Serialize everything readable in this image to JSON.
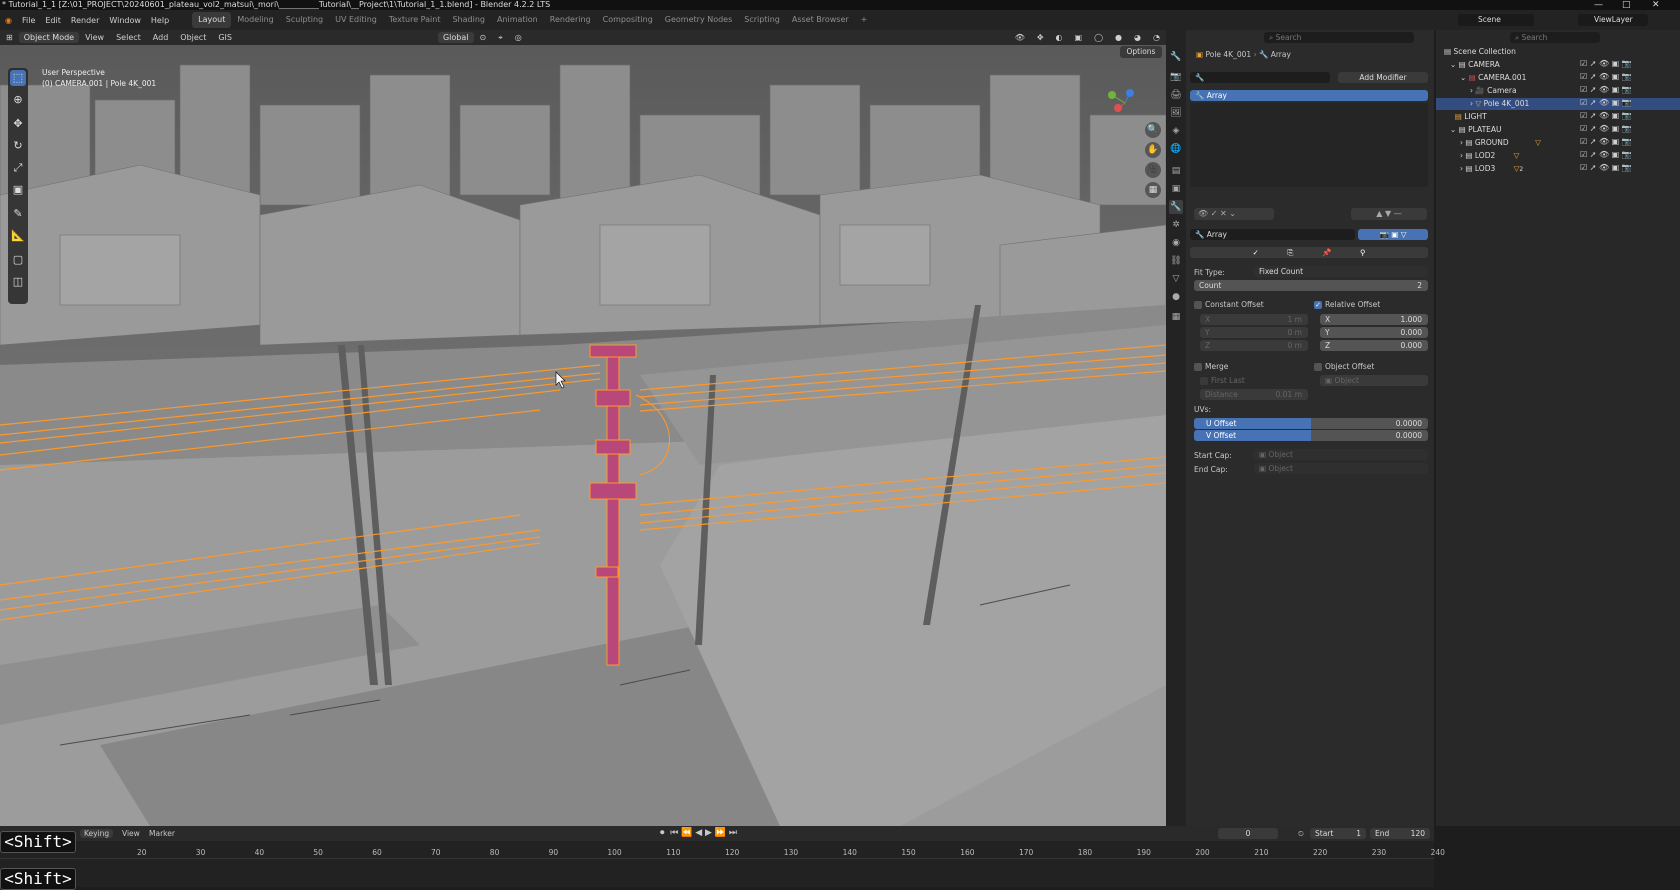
{
  "titlebar": {
    "text": "* Tutorial_1_1 [Z:\\01_PROJECT\\20240601_plateau_vol2_matsui\\_mori\\__________Tutorial\\__Project\\1\\Tutorial_1_1.blend] - Blender 4.2.2 LTS"
  },
  "menubar": {
    "menus": [
      "File",
      "Edit",
      "Render",
      "Window",
      "Help"
    ],
    "workspaces": [
      "Layout",
      "Modeling",
      "Sculpting",
      "UV Editing",
      "Texture Paint",
      "Shading",
      "Animation",
      "Rendering",
      "Compositing",
      "Geometry Nodes",
      "Scripting",
      "Asset Browser"
    ],
    "active_workspace": "Layout",
    "scene": "Scene",
    "view_layer": "ViewLayer"
  },
  "viewport_header": {
    "mode": "Object Mode",
    "items": [
      "View",
      "Select",
      "Add",
      "Object"
    ],
    "gis": "GIS",
    "transform": "Global",
    "options": "Options"
  },
  "viewport": {
    "perspective": "User Perspective",
    "object_info": "(0) CAMERA.001 | Pole 4K_001"
  },
  "properties": {
    "search_placeholder": "Search",
    "breadcrumb_object": "Pole 4K_001",
    "breadcrumb_modifier": "Array",
    "add_modifier": "Add Modifier",
    "modifier_list_item": "Array",
    "modifier_name": "Array",
    "fit_type_label": "Fit Type:",
    "fit_type_value": "Fixed Count",
    "count_label": "Count",
    "count_value": "2",
    "constant_offset": "Constant Offset",
    "relative_offset": "Relative Offset",
    "const_x_label": "X",
    "const_x_value": "1 m",
    "const_y_label": "Y",
    "const_y_value": "0 m",
    "const_z_label": "Z",
    "const_z_value": "0 m",
    "rel_x_label": "X",
    "rel_x_value": "1.000",
    "rel_y_label": "Y",
    "rel_y_value": "0.000",
    "rel_z_label": "Z",
    "rel_z_value": "0.000",
    "merge": "Merge",
    "object_offset": "Object Offset",
    "first_last": "First Last",
    "object_placeholder": "Object",
    "distance_label": "Distance",
    "distance_value": "0.01 m",
    "uvs_label": "UVs:",
    "u_offset_label": "U Offset",
    "u_offset_value": "0.0000",
    "v_offset_label": "V Offset",
    "v_offset_value": "0.0000",
    "uv_fill_fraction": 0.5,
    "start_cap_label": "Start Cap:",
    "end_cap_label": "End Cap:",
    "cap_placeholder": "Object"
  },
  "outliner": {
    "search_placeholder": "Search",
    "root": "Scene Collection",
    "items": [
      {
        "name": "CAMERA",
        "indent": 1
      },
      {
        "name": "CAMERA.001",
        "indent": 2
      },
      {
        "name": "Camera",
        "indent": 3
      },
      {
        "name": "Pole 4K_001",
        "indent": 3,
        "selected": true
      },
      {
        "name": "LIGHT",
        "indent": 1
      },
      {
        "name": "PLATEAU",
        "indent": 1
      },
      {
        "name": "GROUND",
        "indent": 2
      },
      {
        "name": "LOD2",
        "indent": 2
      },
      {
        "name": "LOD3",
        "indent": 2
      }
    ],
    "lod3_badge": "2"
  },
  "timeline": {
    "keying": "Keying",
    "view": "View",
    "marker": "Marker",
    "current_frame": "0",
    "start_label": "Start",
    "start_value": "1",
    "end_label": "End",
    "end_value": "120",
    "ticks": [
      "20",
      "30",
      "40",
      "50",
      "60",
      "70",
      "80",
      "90",
      "100",
      "110",
      "120",
      "130",
      "140",
      "150",
      "160",
      "170",
      "180",
      "190",
      "200",
      "210",
      "220",
      "230",
      "240"
    ]
  },
  "overlay": {
    "key1": "<Shift>",
    "key2": "<Shift>"
  },
  "colors": {
    "accent": "#4772b3",
    "selection": "#ff9a2a",
    "active_object": "#b8477a"
  }
}
